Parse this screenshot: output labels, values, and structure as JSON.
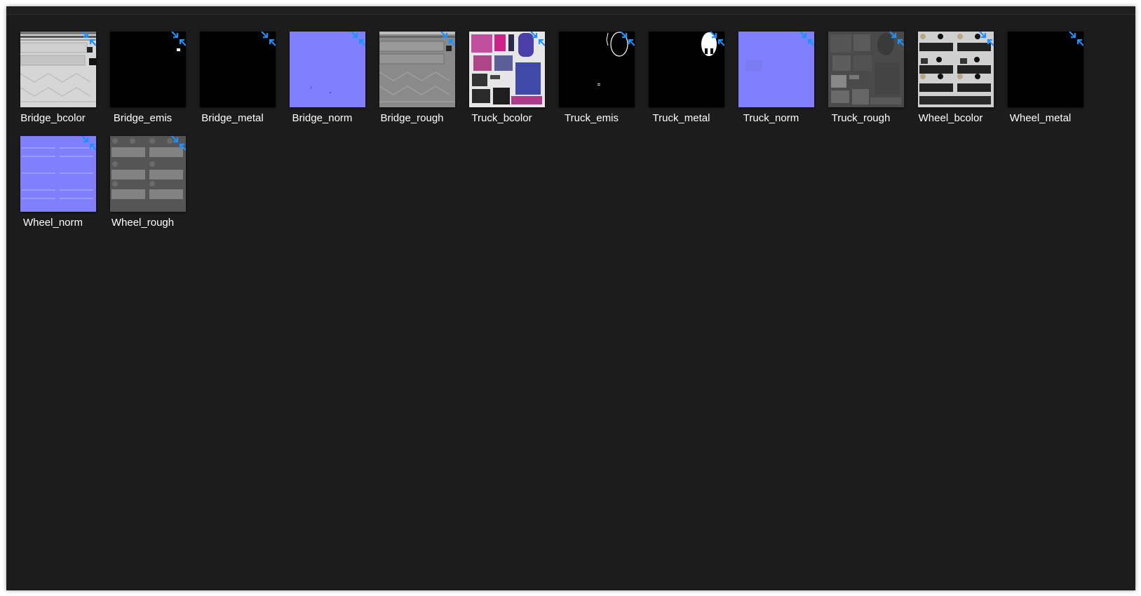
{
  "colors": {
    "background": "#1c1c1c",
    "label_text": "#ffffff",
    "compress_overlay": "#1e90ff"
  },
  "overlay_icon": "compressed-arrows-icon",
  "files": [
    {
      "name": "Bridge_bcolor",
      "thumbnail": "bridge-basecolor-texture"
    },
    {
      "name": "Bridge_emis",
      "thumbnail": "bridge-emissive-texture"
    },
    {
      "name": "Bridge_metal",
      "thumbnail": "bridge-metal-texture"
    },
    {
      "name": "Bridge_norm",
      "thumbnail": "bridge-normal-texture"
    },
    {
      "name": "Bridge_rough",
      "thumbnail": "bridge-roughness-texture"
    },
    {
      "name": "Truck_bcolor",
      "thumbnail": "truck-basecolor-texture"
    },
    {
      "name": "Truck_emis",
      "thumbnail": "truck-emissive-texture"
    },
    {
      "name": "Truck_metal",
      "thumbnail": "truck-metal-texture"
    },
    {
      "name": "Truck_norm",
      "thumbnail": "truck-normal-texture"
    },
    {
      "name": "Truck_rough",
      "thumbnail": "truck-roughness-texture"
    },
    {
      "name": "Wheel_bcolor",
      "thumbnail": "wheel-basecolor-texture"
    },
    {
      "name": "Wheel_metal",
      "thumbnail": "wheel-metal-texture"
    },
    {
      "name": "Wheel_norm",
      "thumbnail": "wheel-normal-texture"
    },
    {
      "name": "Wheel_rough",
      "thumbnail": "wheel-roughness-texture"
    }
  ]
}
